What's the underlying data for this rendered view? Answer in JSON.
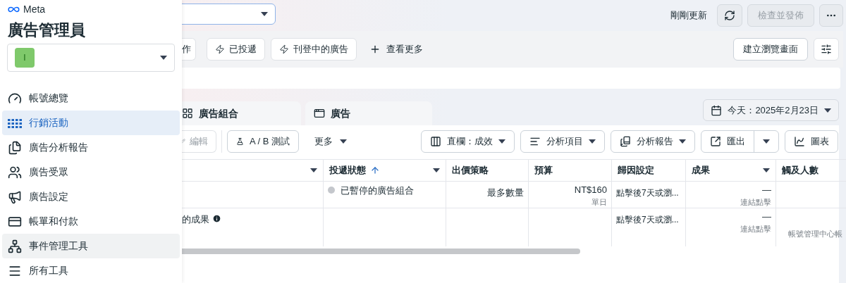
{
  "sidebar": {
    "brand": "Meta",
    "title": "廣告管理員",
    "account": {
      "avatar_letter": "I"
    },
    "items": [
      {
        "label": "帳號總覽",
        "selected": false,
        "hovered": false
      },
      {
        "label": "行銷活動",
        "selected": true,
        "hovered": false
      },
      {
        "label": "廣告分析報告",
        "selected": false,
        "hovered": false
      },
      {
        "label": "廣告受眾",
        "selected": false,
        "hovered": false
      },
      {
        "label": "廣告設定",
        "selected": false,
        "hovered": false
      },
      {
        "label": "帳單和付款",
        "selected": false,
        "hovered": false
      },
      {
        "label": "事件管理工具",
        "selected": false,
        "hovered": true
      },
      {
        "label": "所有工具",
        "selected": false,
        "hovered": false
      }
    ]
  },
  "topbar": {
    "status": "剛剛更新",
    "publish_button": {
      "label": "檢查並發佈",
      "disabled": true
    }
  },
  "filters": [
    {
      "label": "作"
    },
    {
      "label": "已投遞"
    },
    {
      "label": "刊登中的廣告"
    }
  ],
  "see_more": "查看更多",
  "create_view": "建立瀏覽畫面",
  "tabs": [
    {
      "label": "廣告組合",
      "selected": false
    },
    {
      "label": "廣告",
      "selected": false
    }
  ],
  "date_button": "今天：2025年2月23日",
  "toolbar": {
    "edit": {
      "label": "編輯",
      "disabled": true
    },
    "ab_test": "A / B 測試",
    "more": "更多",
    "columns": "直欄：成效",
    "breakdown": "分析項目",
    "reports": "分析報告",
    "export": "匯出",
    "chart": "圖表"
  },
  "table": {
    "columns": [
      {
        "menu": true,
        "sorted": false
      },
      {
        "label": "投遞狀態",
        "menu": true,
        "sorted": true
      },
      {
        "label": "出價策略",
        "menu": false,
        "sorted": false
      },
      {
        "label": "預算",
        "menu": false,
        "sorted": false
      },
      {
        "label": "歸因設定",
        "menu": false,
        "sorted": false
      },
      {
        "label": "成果",
        "menu": true,
        "sorted": false
      },
      {
        "label": "觸及人數",
        "menu": false,
        "sorted": false
      }
    ],
    "rows": [
      {
        "status": {
          "label": "已暫停的廣告組合",
          "color": "#c4c7cc"
        },
        "bid": "最多數量",
        "budget": {
          "amount": "NT$160",
          "period": "單日"
        },
        "attribution": "點擊後7天或瀏...",
        "results": {
          "value": "—",
          "type": "連結點擊"
        }
      },
      {
        "name": "的成果",
        "attribution": "點擊後7天或瀏...",
        "results": {
          "value": "—",
          "type": "連結點擊"
        },
        "reach": "帳號管理中心帳"
      }
    ]
  }
}
